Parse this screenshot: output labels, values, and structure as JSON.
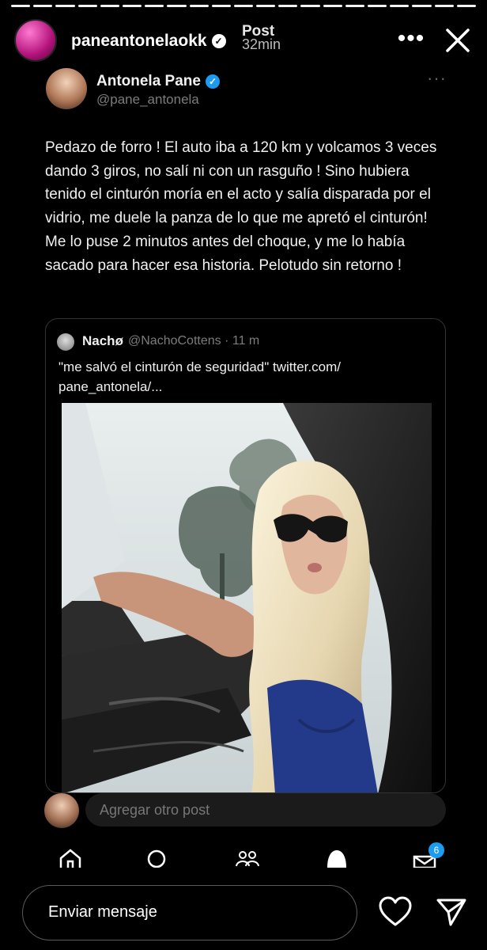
{
  "story": {
    "username": "paneantonelaokk",
    "label": "Post",
    "time": "32min",
    "segments": 21,
    "filled_segments": 21
  },
  "tweet": {
    "name": "Antonela Pane",
    "handle": "@pane_antonela",
    "more": "···",
    "text": "Pedazo de forro ! El auto iba a 120 km y volcamos 3 veces dando 3 giros, no salí ni con un rasguño ! Sino hubiera tenido el cinturón moría en el acto y salía disparada por el vidrio, me duele la panza de lo que me apretó el cinturón! Me lo puse 2 minutos antes del choque, y me lo había sacado para hacer esa historia. Pelotudo sin retorno !"
  },
  "quote": {
    "name": "Nachø",
    "handle": "@NachoCottens · 11 m",
    "text": "\"me salvó el cinturón de seguridad\" twitter.com/ pane_antonela/..."
  },
  "reply": {
    "placeholder": "Agregar otro post"
  },
  "nav": {
    "items": [
      "home-icon",
      "search-icon",
      "communities-icon",
      "notifications-icon",
      "messages-icon"
    ],
    "badge": "6"
  },
  "message": {
    "placeholder": "Enviar mensaje"
  },
  "colors": {
    "background": "#000000",
    "accent": "#1d9bf0",
    "secondary_text": "#7c7c7c"
  }
}
